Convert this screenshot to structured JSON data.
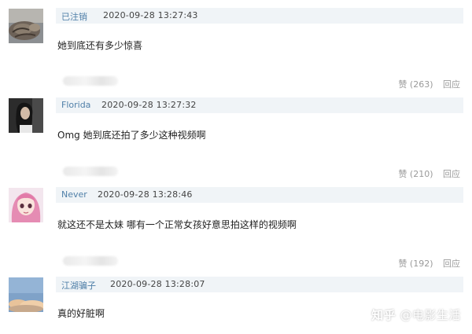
{
  "comments": [
    {
      "username": "已注销",
      "timestamp": "2020-09-28 13:27:43",
      "text": "她到底还有多少惊喜",
      "avatar": "tabby-cat-photo"
    },
    {
      "username": "Florida",
      "timestamp": "2020-09-28 13:27:32",
      "text": "Omg 她到底还拍了多少这种视频啊",
      "avatar": "dark-haired-woman-photo"
    },
    {
      "username": "Never",
      "timestamp": "2020-09-28 13:28:46",
      "text": "就这还不是太妹 哪有一个正常女孩好意思拍这样的视频啊",
      "avatar": "pink-anime-girl-photo"
    },
    {
      "username": "江湖骗子",
      "timestamp": "2020-09-28 13:28:07",
      "text": "真的好脏啊",
      "avatar": "cloudy-sky-photo"
    }
  ],
  "actions": [
    {
      "like": "赞 (263)",
      "reply": "回应"
    },
    {
      "like": "赞 (210)",
      "reply": "回应"
    },
    {
      "like": "赞 (192)",
      "reply": "回应"
    }
  ],
  "watermark": {
    "brand": "知乎",
    "handle": "@电影生活"
  },
  "colors": {
    "username": "#4f7fa8",
    "header_bar": "#f0f4f7",
    "action_text": "#9a9a9a"
  }
}
